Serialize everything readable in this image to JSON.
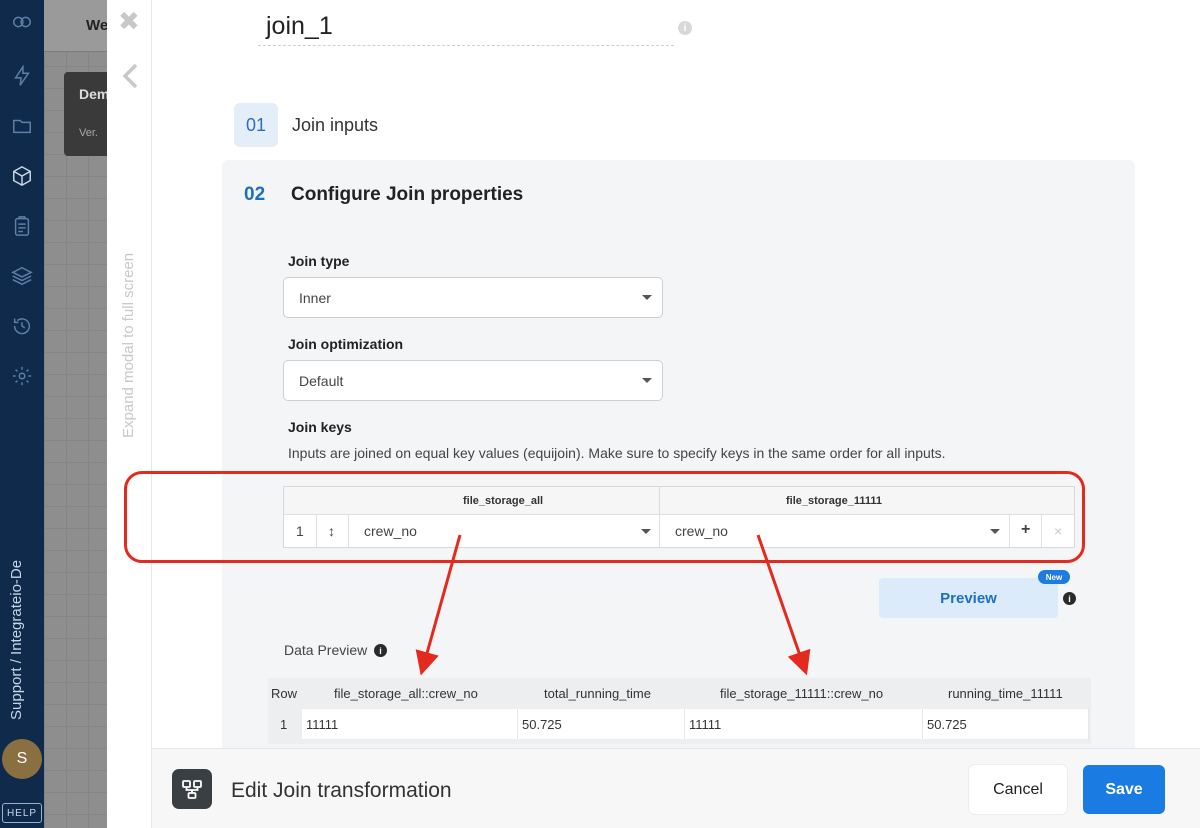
{
  "nav": {
    "breadcrumb_vertical": "Support / Integrateio-De",
    "avatar_initial": "S",
    "help_label": "HELP"
  },
  "background": {
    "tab_fragment": "We",
    "card_title_fragment": "Dem",
    "card_sub_fragment": "Ver."
  },
  "modal": {
    "close_symbol": "✖",
    "expand_text": "Expand modal to full screen",
    "component_name": "join_1",
    "info_symbol": "i",
    "step1": {
      "number": "01",
      "label": "Join inputs"
    },
    "step2": {
      "number": "02",
      "label": "Configure Join properties"
    },
    "join_type": {
      "label": "Join type",
      "value": "Inner"
    },
    "join_optimization": {
      "label": "Join optimization",
      "value": "Default"
    },
    "join_keys": {
      "label": "Join keys",
      "help": "Inputs are joined on equal key values (equijoin). Make sure to specify keys in the same order for all inputs.",
      "columns": [
        "file_storage_all",
        "file_storage_11111"
      ],
      "rows": [
        {
          "index": "1",
          "drag": "↕",
          "left": "crew_no",
          "right": "crew_no",
          "add": "+",
          "remove": "×"
        }
      ]
    },
    "preview": {
      "button": "Preview",
      "badge": "New"
    },
    "data_preview": {
      "label": "Data Preview",
      "headers": [
        "Row",
        "file_storage_all::crew_no",
        "total_running_time",
        "file_storage_11111::crew_no",
        "running_time_11111"
      ],
      "rows": [
        [
          "1",
          "11111",
          "50.725",
          "11111",
          "50.725"
        ]
      ]
    }
  },
  "footer": {
    "title": "Edit Join transformation",
    "cancel": "Cancel",
    "save": "Save"
  },
  "colors": {
    "accent": "#1a7be2",
    "highlight": "#e22b1e",
    "nav_bg": "#0f2a4a"
  }
}
